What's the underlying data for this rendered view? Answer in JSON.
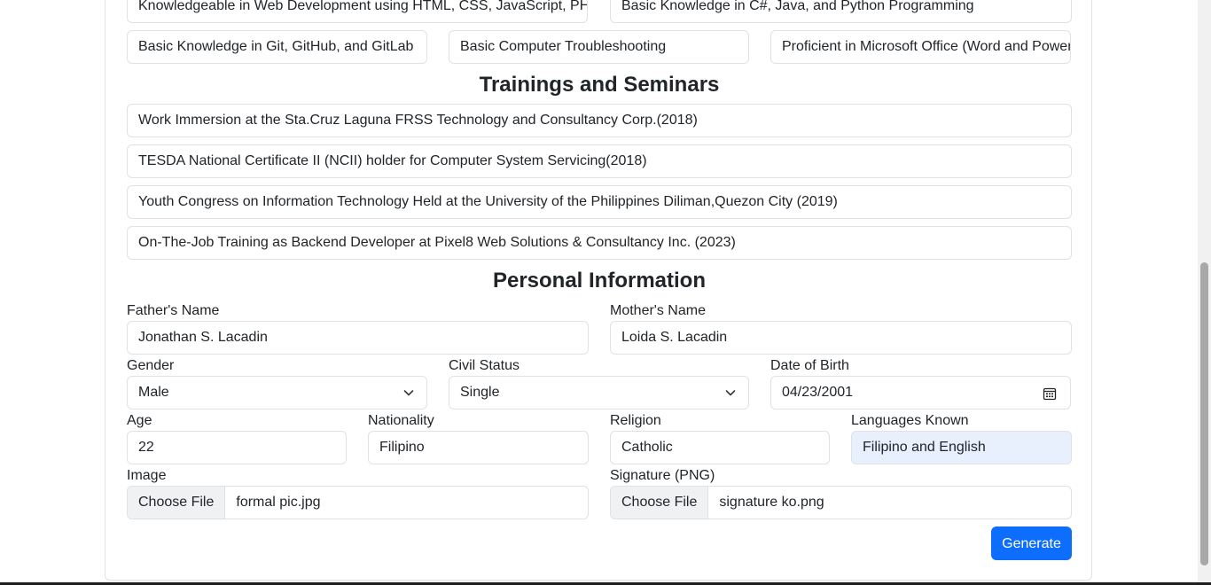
{
  "skills": {
    "row1": [
      "Knowledgeable in Web Development using HTML, CSS, JavaScript, PHP",
      "Basic Knowledge in C#, Java, and Python Programming"
    ],
    "row2": [
      "Basic Knowledge in Git, GitHub, and GitLab",
      "Basic Computer Troubleshooting",
      "Proficient in Microsoft Office (Word and PowerPoint)"
    ]
  },
  "trainings": {
    "title": "Trainings and Seminars",
    "items": [
      "Work Immersion at the Sta.Cruz Laguna FRSS Technology and Consultancy Corp.(2018)",
      "TESDA National Certificate II (NCII) holder for Computer System Servicing(2018)",
      "Youth Congress on Information Technology Held at the University of the Philippines Diliman,Quezon City (2019)",
      "On-The-Job Training as Backend Developer at Pixel8 Web Solutions & Consultancy Inc. (2023)"
    ]
  },
  "personal": {
    "title": "Personal Information",
    "father_label": "Father's Name",
    "father_value": "Jonathan S. Lacadin",
    "mother_label": "Mother's Name",
    "mother_value": "Loida S. Lacadin",
    "gender_label": "Gender",
    "gender_value": "Male",
    "civil_label": "Civil Status",
    "civil_value": "Single",
    "dob_label": "Date of Birth",
    "dob_value": "04/23/2001",
    "age_label": "Age",
    "age_value": "22",
    "nationality_label": "Nationality",
    "nationality_value": "Filipino",
    "religion_label": "Religion",
    "religion_value": "Catholic",
    "languages_label": "Languages Known",
    "languages_value": "Filipino and English",
    "image_label": "Image",
    "image_button": "Choose File",
    "image_file": "formal pic.jpg",
    "signature_label": "Signature (PNG)",
    "signature_button": "Choose File",
    "signature_file": "signature ko.png"
  },
  "actions": {
    "generate_label": "Generate"
  },
  "colors": {
    "primary": "#0d6efd",
    "autofill": "#e8f0fe",
    "border": "#dee2e6"
  },
  "icons": {
    "select": "chevron-down-icon",
    "date": "calendar-icon"
  }
}
